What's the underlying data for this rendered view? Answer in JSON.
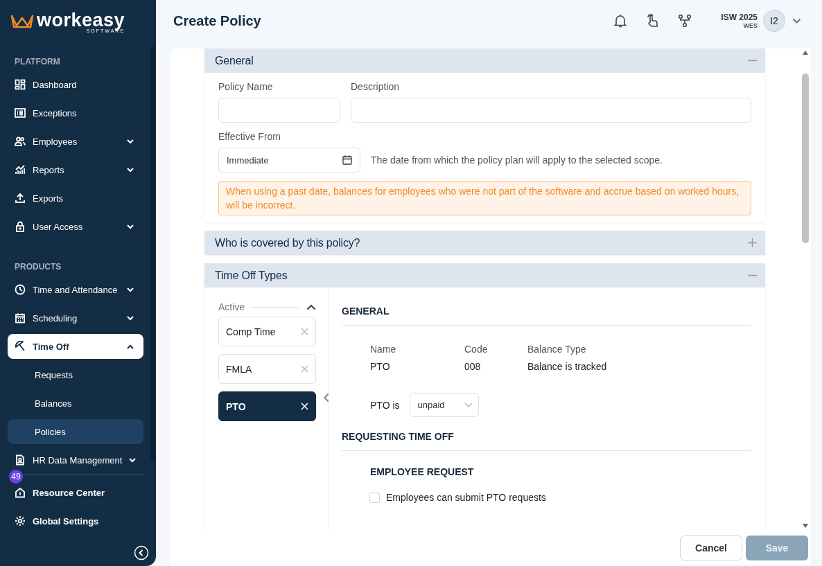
{
  "logo": {
    "name": "workeasy",
    "tagline": "SOFTWARE"
  },
  "sidebar": {
    "groups": [
      {
        "heading": "PLATFORM",
        "items": [
          {
            "label": "Dashboard",
            "has_submenu": false,
            "selected": false
          },
          {
            "label": "Exceptions",
            "has_submenu": false,
            "selected": false
          },
          {
            "label": "Employees",
            "has_submenu": true,
            "expanded": false,
            "selected": false
          },
          {
            "label": "Reports",
            "has_submenu": true,
            "expanded": false,
            "selected": false
          },
          {
            "label": "Exports",
            "has_submenu": false,
            "selected": false
          },
          {
            "label": "User Access",
            "has_submenu": true,
            "expanded": false,
            "selected": false
          }
        ]
      },
      {
        "heading": "PRODUCTS",
        "items": [
          {
            "label": "Time and Attendance",
            "has_submenu": true,
            "expanded": false,
            "selected": false
          },
          {
            "label": "Scheduling",
            "has_submenu": true,
            "expanded": false,
            "selected": false
          },
          {
            "label": "Time Off",
            "has_submenu": true,
            "expanded": true,
            "selected": true,
            "children": [
              {
                "label": "Requests",
                "selected": false
              },
              {
                "label": "Balances",
                "selected": false
              },
              {
                "label": "Policies",
                "selected": true
              }
            ]
          },
          {
            "label": "HR Data Management",
            "has_submenu": true,
            "expanded": false,
            "selected": false
          }
        ]
      }
    ],
    "footer_items": [
      {
        "label": "Resource Center",
        "badge": "49"
      },
      {
        "label": "Global Settings"
      }
    ]
  },
  "header": {
    "title": "Create Policy",
    "org": "ISW 2025",
    "org_code": "WES",
    "avatar": "I2"
  },
  "sections": [
    {
      "kind": "general",
      "title": "General",
      "expanded": true,
      "fields": [
        {
          "label": "Policy Name"
        },
        {
          "label": "Description"
        }
      ],
      "effective_from": {
        "label": "Effective From",
        "value": "Immediate",
        "hint": "The date from which the policy plan will apply to the selected scope."
      },
      "warning": "When using a past date, balances for employees who were not part of the software and accrue based on worked hours, will be incorrect."
    },
    {
      "kind": "coverage",
      "title": "Who is covered by this policy?",
      "expanded": false
    },
    {
      "kind": "types",
      "title": "Time Off Types",
      "expanded": true,
      "list_heading": "Active",
      "list_expanded": true,
      "types": [
        {
          "label": "Comp Time",
          "selected": false
        },
        {
          "label": "FMLA",
          "selected": false
        },
        {
          "label": "PTO",
          "selected": true
        }
      ],
      "detail": {
        "heading": "GENERAL",
        "info": [
          {
            "label": "Name",
            "value": "PTO"
          },
          {
            "label": "Code",
            "value": "008"
          },
          {
            "label": "Balance Type",
            "value": "Balance is tracked"
          }
        ],
        "paid_label": "PTO is",
        "paid_value": "unpaid",
        "request_heading": "REQUESTING TIME OFF",
        "request_subheading": "EMPLOYEE REQUEST",
        "options": [
          {
            "label": "Employees can submit PTO requests",
            "checked": false
          }
        ]
      }
    }
  ],
  "buttons": [
    {
      "label": "Cancel",
      "kind": "secondary",
      "disabled": false
    },
    {
      "label": "Save",
      "kind": "primary",
      "disabled": true
    }
  ]
}
